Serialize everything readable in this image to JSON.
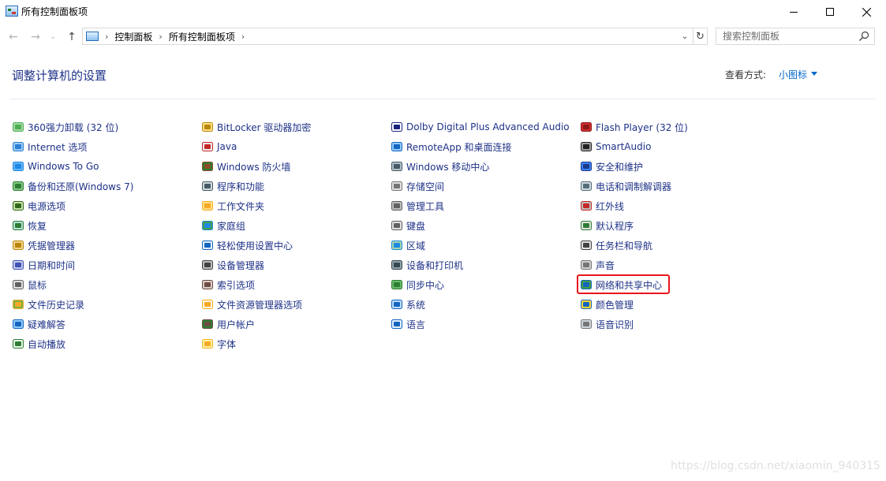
{
  "window": {
    "title": "所有控制面板项",
    "minimize_icon": "minimize-icon",
    "maximize_icon": "maximize-icon",
    "close_icon": "close-icon"
  },
  "navigation": {
    "back": "←",
    "forward": "→",
    "recent": "⌄",
    "up": "↑",
    "breadcrumb": [
      "控制面板",
      "所有控制面板项"
    ],
    "dropdown": "⌄",
    "refresh": "↻",
    "search_placeholder": "搜索控制面板"
  },
  "header": {
    "title": "调整计算机的设置",
    "view_by_label": "查看方式:",
    "view_by_value": "小图标"
  },
  "columns": [
    {
      "items": [
        {
          "label": "360强力卸载 (32 位)",
          "icon": "uninstall-icon"
        },
        {
          "label": "Internet 选项",
          "icon": "internet-options-icon"
        },
        {
          "label": "Windows To Go",
          "icon": "windows-to-go-icon"
        },
        {
          "label": "备份和还原(Windows 7)",
          "icon": "backup-restore-icon"
        },
        {
          "label": "电源选项",
          "icon": "power-options-icon"
        },
        {
          "label": "恢复",
          "icon": "recovery-icon"
        },
        {
          "label": "凭据管理器",
          "icon": "credential-manager-icon"
        },
        {
          "label": "日期和时间",
          "icon": "date-time-icon"
        },
        {
          "label": "鼠标",
          "icon": "mouse-icon"
        },
        {
          "label": "文件历史记录",
          "icon": "file-history-icon"
        },
        {
          "label": "疑难解答",
          "icon": "troubleshooting-icon"
        },
        {
          "label": "自动播放",
          "icon": "autoplay-icon"
        }
      ]
    },
    {
      "items": [
        {
          "label": "BitLocker 驱动器加密",
          "icon": "bitlocker-icon"
        },
        {
          "label": "Java",
          "icon": "java-icon"
        },
        {
          "label": "Windows 防火墙",
          "icon": "firewall-icon"
        },
        {
          "label": "程序和功能",
          "icon": "programs-features-icon"
        },
        {
          "label": "工作文件夹",
          "icon": "work-folders-icon"
        },
        {
          "label": "家庭组",
          "icon": "homegroup-icon"
        },
        {
          "label": "轻松使用设置中心",
          "icon": "ease-of-access-icon"
        },
        {
          "label": "设备管理器",
          "icon": "device-manager-icon"
        },
        {
          "label": "索引选项",
          "icon": "indexing-options-icon"
        },
        {
          "label": "文件资源管理器选项",
          "icon": "explorer-options-icon"
        },
        {
          "label": "用户帐户",
          "icon": "user-accounts-icon"
        },
        {
          "label": "字体",
          "icon": "fonts-icon"
        }
      ]
    },
    {
      "items": [
        {
          "label": "Dolby Digital Plus Advanced Audio",
          "icon": "dolby-icon"
        },
        {
          "label": "RemoteApp 和桌面连接",
          "icon": "remoteapp-icon"
        },
        {
          "label": "Windows 移动中心",
          "icon": "mobility-center-icon"
        },
        {
          "label": "存储空间",
          "icon": "storage-spaces-icon"
        },
        {
          "label": "管理工具",
          "icon": "admin-tools-icon"
        },
        {
          "label": "键盘",
          "icon": "keyboard-icon"
        },
        {
          "label": "区域",
          "icon": "region-icon"
        },
        {
          "label": "设备和打印机",
          "icon": "devices-printers-icon"
        },
        {
          "label": "同步中心",
          "icon": "sync-center-icon"
        },
        {
          "label": "系统",
          "icon": "system-icon"
        },
        {
          "label": "语言",
          "icon": "language-icon"
        }
      ]
    },
    {
      "items": [
        {
          "label": "Flash Player (32 位)",
          "icon": "flash-player-icon"
        },
        {
          "label": "SmartAudio",
          "icon": "smartaudio-icon"
        },
        {
          "label": "安全和维护",
          "icon": "security-maintenance-icon"
        },
        {
          "label": "电话和调制解调器",
          "icon": "phone-modem-icon"
        },
        {
          "label": "红外线",
          "icon": "infrared-icon"
        },
        {
          "label": "默认程序",
          "icon": "default-programs-icon"
        },
        {
          "label": "任务栏和导航",
          "icon": "taskbar-icon"
        },
        {
          "label": "声音",
          "icon": "sound-icon"
        },
        {
          "label": "网络和共享中心",
          "icon": "network-sharing-icon",
          "highlighted": true
        },
        {
          "label": "颜色管理",
          "icon": "color-management-icon"
        },
        {
          "label": "语音识别",
          "icon": "speech-recognition-icon"
        }
      ]
    }
  ],
  "colors": {
    "link": "#1e3287",
    "accent": "#0066cc",
    "highlight_border": "#e8151c"
  },
  "watermark": "https://blog.csdn.net/xiaomin_940315"
}
